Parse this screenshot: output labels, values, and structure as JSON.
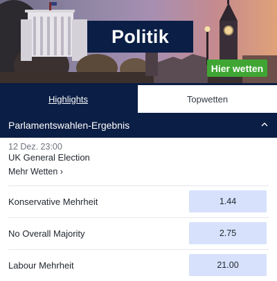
{
  "banner": {
    "title": "Politik",
    "cta_label": "Hier wetten"
  },
  "tabs": [
    {
      "label": "Highlights",
      "active": true
    },
    {
      "label": "Topwetten",
      "active": false
    }
  ],
  "section": {
    "title": "Parlamentswahlen-Ergebnis"
  },
  "event": {
    "date": "12 Dez. 23:00",
    "name": "UK General Election",
    "more_label": "Mehr Wetten ›"
  },
  "markets": [
    {
      "selection": "Konservative Mehrheit",
      "odds": "1.44"
    },
    {
      "selection": "No Overall Majority",
      "odds": "2.75"
    },
    {
      "selection": "Labour Mehrheit",
      "odds": "21.00"
    }
  ],
  "colors": {
    "navy": "#0b1e45",
    "cta_green": "#3fa634",
    "odds_bg": "#d7e1fb"
  }
}
